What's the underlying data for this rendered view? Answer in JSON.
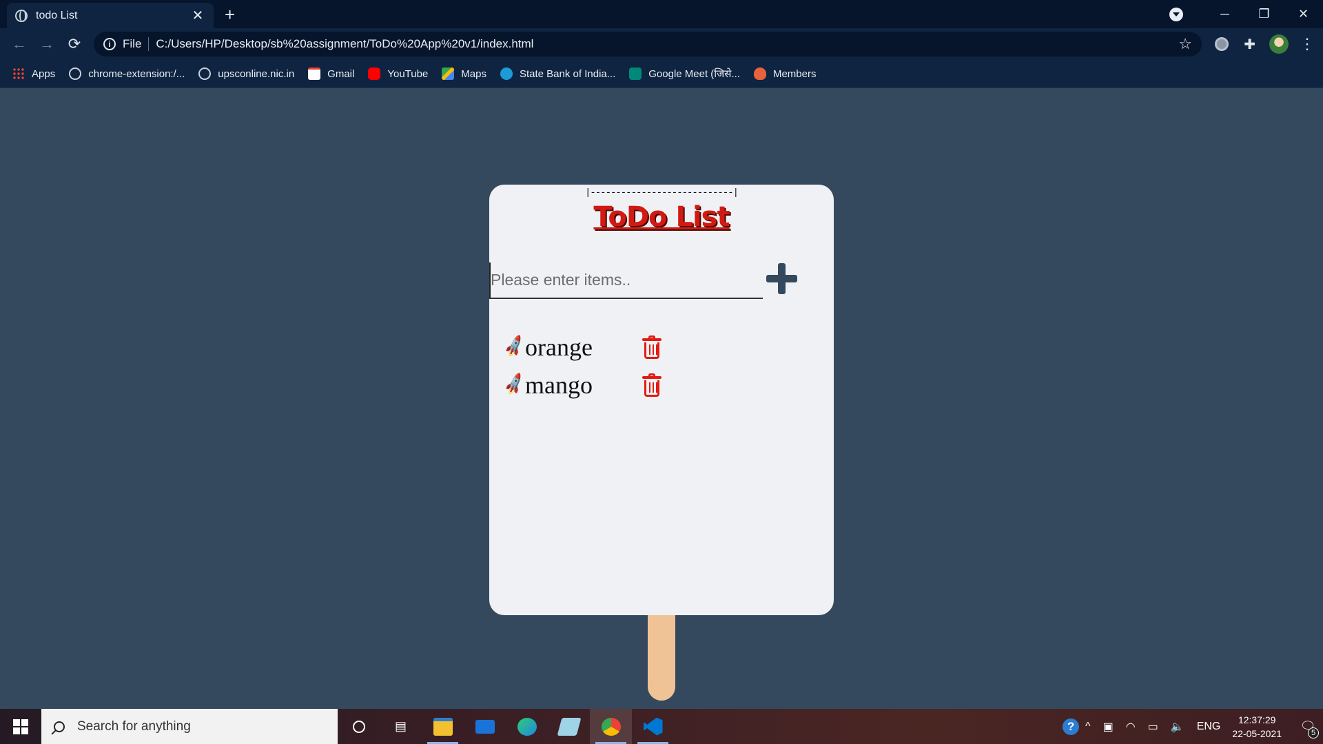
{
  "browser": {
    "tab_title": "todo List",
    "tab_close": "✕",
    "new_tab": "+",
    "window_controls": {
      "minimize": "─",
      "restore": "❐",
      "close": "✕"
    },
    "scheme": "File",
    "url": "C:/Users/HP/Desktop/sb%20assignment/ToDo%20App%20v1/index.html",
    "nav": {
      "back": "←",
      "forward": "→",
      "reload": "⟳"
    },
    "bookmarks": [
      {
        "label": "Apps",
        "icon": "apps-grid-icon"
      },
      {
        "label": "chrome-extension:/...",
        "icon": "globe-icon"
      },
      {
        "label": "upsconline.nic.in",
        "icon": "globe-icon"
      },
      {
        "label": "Gmail",
        "icon": "gmail-icon"
      },
      {
        "label": "YouTube",
        "icon": "youtube-icon"
      },
      {
        "label": "Maps",
        "icon": "maps-icon"
      },
      {
        "label": "State Bank of India...",
        "icon": "sbi-icon"
      },
      {
        "label": "Google Meet (जिसे...",
        "icon": "meet-icon"
      },
      {
        "label": "Members",
        "icon": "members-icon"
      }
    ]
  },
  "app": {
    "top_dashes": "|----------------------------|",
    "title": "ToDo List",
    "input": {
      "placeholder": "Please enter items..",
      "value": ""
    },
    "add_button_icon": "plus-icon",
    "items": [
      {
        "text": "orange",
        "bullet": "🚀"
      },
      {
        "text": "mango",
        "bullet": "🚀"
      }
    ],
    "colors": {
      "page_bg": "#34495e",
      "card_bg": "#f0f1f4",
      "title": "#d21a12",
      "delete": "#e31b12",
      "stick": "#f0c397"
    }
  },
  "taskbar": {
    "search_placeholder": "Search for anything",
    "apps": [
      "cortana-icon",
      "task-view-icon",
      "file-explorer-icon",
      "mail-icon",
      "edge-icon",
      "notepad-icon",
      "chrome-icon",
      "vscode-icon"
    ],
    "tray": {
      "lang": "ENG",
      "time": "12:37:29",
      "date": "22-05-2021",
      "notifications": "5"
    }
  }
}
